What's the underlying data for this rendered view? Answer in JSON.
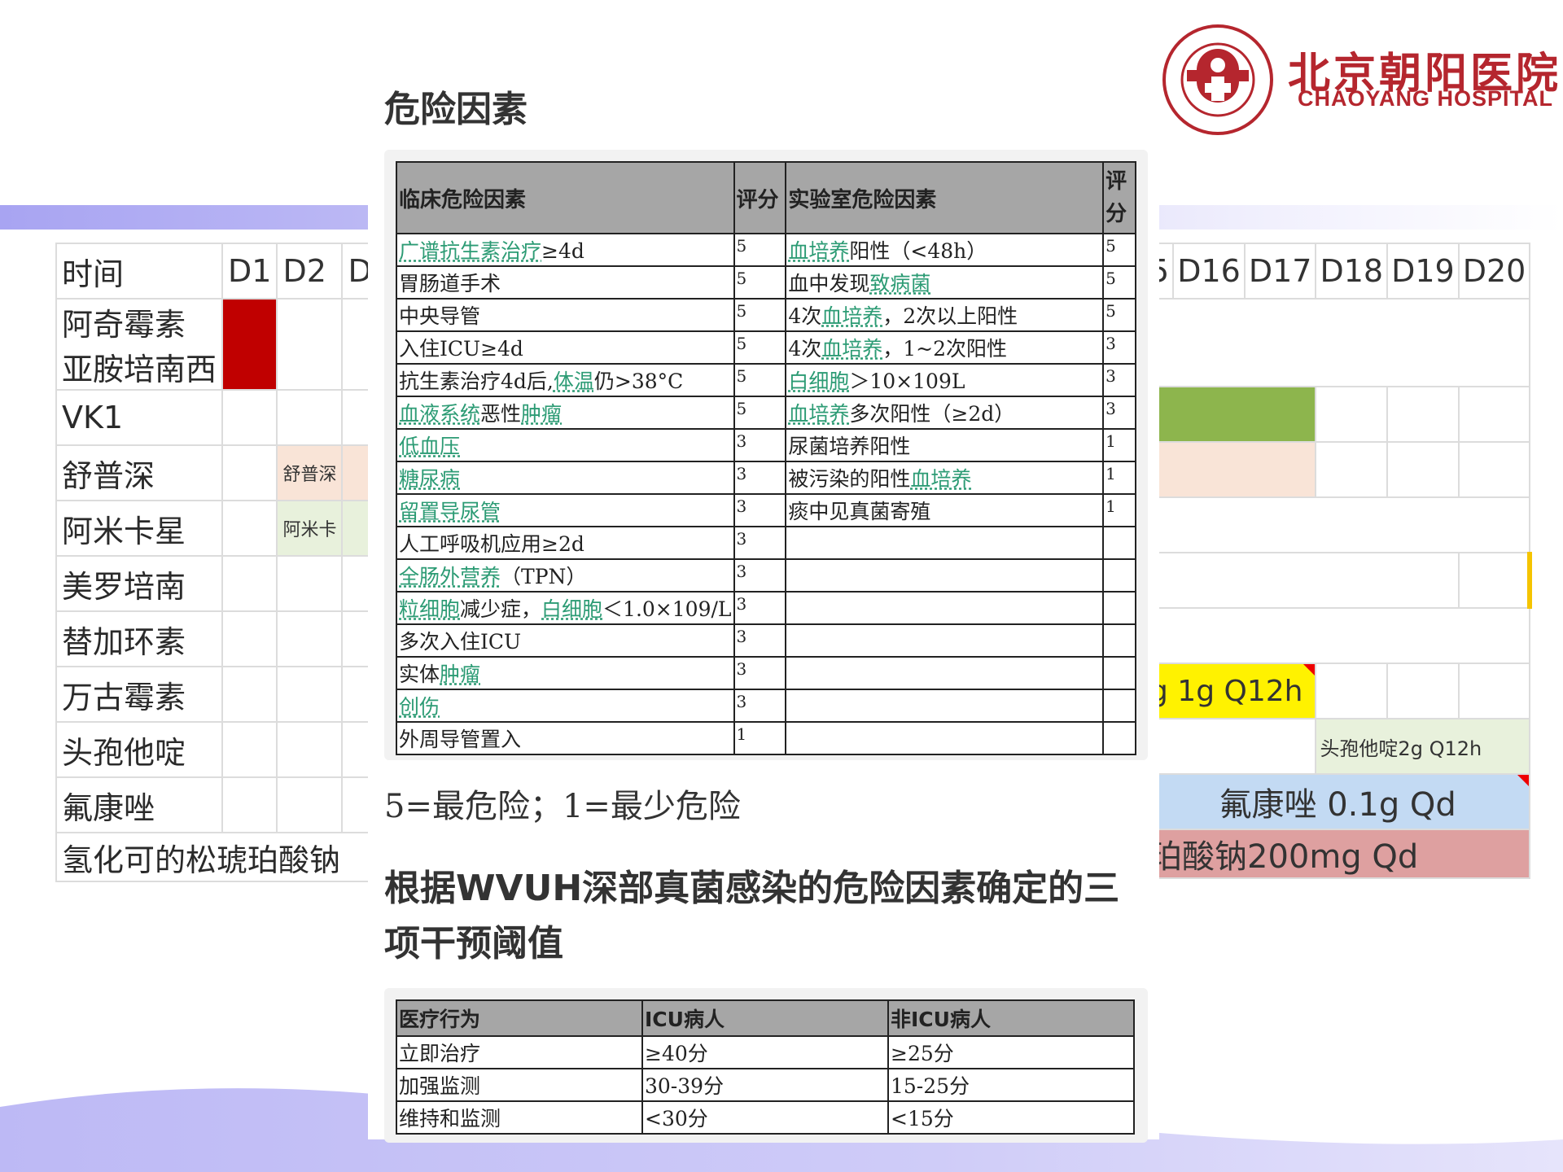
{
  "logo": {
    "name_cn": "北京朝阳医院",
    "name_en": "CHAOYANG HOSPITAL",
    "seal_text": "北京朝阳医院 BEIJING CHAO-YANG HOSPITAL",
    "color": "#b5262e"
  },
  "title": "危险因素",
  "risk_table": {
    "headers": [
      "临床危险因素",
      "评分",
      "实验室危险因素",
      "评分"
    ],
    "rows": [
      [
        "广谱抗生素治疗≥4d",
        "5",
        "血培养阳性（<48h）",
        "5"
      ],
      [
        "胃肠道手术",
        "5",
        "血中发现致病菌",
        "5"
      ],
      [
        "中央导管",
        "5",
        "4次血培养，2次以上阳性",
        "5"
      ],
      [
        "入住ICU≥4d",
        "5",
        "4次血培养，1~2次阳性",
        "3"
      ],
      [
        "抗生素治疗4d后,体温仍>38°C",
        "5",
        "白细胞＞10×109L",
        "3"
      ],
      [
        "血液系统恶性肿瘤",
        "5",
        "血培养多次阳性（≥2d）",
        "3"
      ],
      [
        "低血压",
        "3",
        "尿菌培养阳性",
        "1"
      ],
      [
        "糖尿病",
        "3",
        "被污染的阳性血培养",
        "1"
      ],
      [
        "留置导尿管",
        "3",
        "痰中见真菌寄殖",
        "1"
      ],
      [
        "人工呼吸机应用≥2d",
        "3",
        "",
        ""
      ],
      [
        "全肠外营养（TPN）",
        "3",
        "",
        ""
      ],
      [
        "粒细胞减少症，白细胞＜1.0×109/L",
        "3",
        "",
        ""
      ],
      [
        "多次入住ICU",
        "3",
        "",
        ""
      ],
      [
        "实体肿瘤",
        "3",
        "",
        ""
      ],
      [
        "创伤",
        "3",
        "",
        ""
      ],
      [
        "外周导管置入",
        "1",
        "",
        ""
      ]
    ]
  },
  "note": "5=最危险；1=最少危险",
  "subtitle": "根据WVUH深部真菌感染的危险因素确定的三项干预阈值",
  "threshold_table": {
    "headers": [
      "医疗行为",
      "ICU病人",
      "非ICU病人"
    ],
    "rows": [
      [
        "立即治疗",
        "≥40分",
        "≥25分"
      ],
      [
        "加强监测",
        "30-39分",
        "15-25分"
      ],
      [
        "维持和监测",
        "<30分",
        "<15分"
      ]
    ]
  },
  "schedule": {
    "left_header": [
      "时间",
      "D1",
      "D2",
      "D"
    ],
    "drugs": [
      "阿奇霉素",
      "亚胺培南西",
      "VK1",
      "舒普深",
      "阿米卡星",
      "美罗培南",
      "替加环素",
      "万古霉素",
      "头孢他啶",
      "氟康唑",
      "氢化可的松琥珀酸钠"
    ],
    "left_bars": {
      "shupushen": "舒普深",
      "amikaxing": "阿米卡"
    },
    "right_header": [
      "5",
      "D16",
      "D17",
      "D18",
      "D19",
      "D20"
    ],
    "right_labels": {
      "vancomycin": "g 1g Q12h",
      "ceftazidime": "头孢他啶2g Q12h",
      "fluconazole": "氟康唑 0.1g Qd",
      "hydrocortisone": "珀酸钠200mg Qd"
    }
  },
  "colors": {
    "header_gray": "#a6a6a6",
    "link_green": "#2c9b74",
    "schedule_red": "#c00000",
    "schedule_green": "#8db54d",
    "schedule_yellow": "#fff200",
    "schedule_blue": "#c3daf3",
    "schedule_pink": "#dea0a0",
    "accent_purple": "#a8a4f2"
  }
}
